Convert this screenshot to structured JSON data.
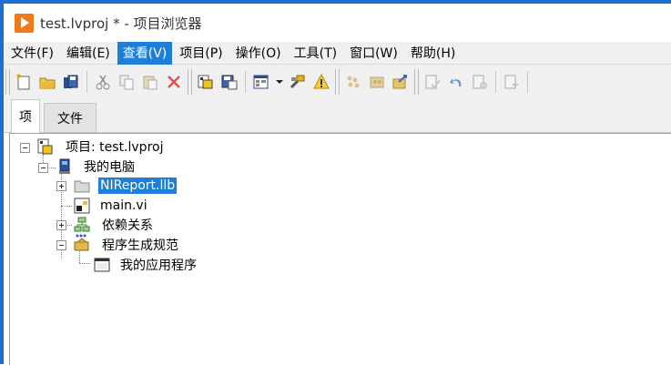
{
  "window": {
    "title": "test.lvproj * - 项目浏览器"
  },
  "menu": {
    "items": [
      "文件(F)",
      "编辑(E)",
      "查看(V)",
      "项目(P)",
      "操作(O)",
      "工具(T)",
      "窗口(W)",
      "帮助(H)"
    ],
    "active_index": 2
  },
  "toolbar": {
    "icons": [
      "new-icon",
      "open-icon",
      "save-all-icon",
      "cut-icon",
      "copy-icon",
      "paste-icon",
      "delete-icon",
      "project-properties-icon",
      "save-project-icon",
      "view-dropdown-icon",
      "tools-icon",
      "warning-icon",
      "build-icon",
      "build-all-icon",
      "deploy-icon",
      "check-icon",
      "undo-icon",
      "resolve-icon",
      "add-icon"
    ]
  },
  "tabs": {
    "items": [
      "项",
      "文件"
    ],
    "selected_index": 0
  },
  "tree": {
    "project_label": "项目: test.lvproj",
    "computer_label": "我的电脑",
    "llb_label": "NIReport.llb",
    "vi_label": "main.vi",
    "deps_label": "依赖关系",
    "build_label": "程序生成规范",
    "app_label": "我的应用程序"
  },
  "colors": {
    "selection": "#1e7fd8",
    "accent_orange": "#ee7a1d",
    "window_border": "#1e6fd4"
  }
}
